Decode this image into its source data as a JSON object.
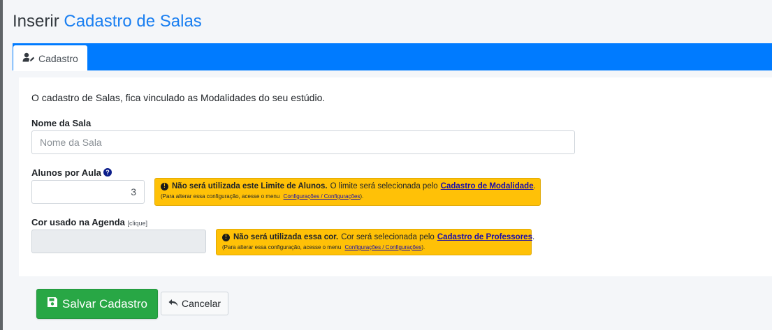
{
  "header": {
    "title_prefix": "Inserir",
    "title_main": "Cadastro de Salas"
  },
  "tabs": [
    {
      "label": "Cadastro",
      "icon": "user-edit-icon",
      "active": true
    }
  ],
  "form": {
    "intro": "O cadastro de Salas, fica vinculado as Modalidades do seu estúdio.",
    "nome_sala": {
      "label": "Nome da Sala",
      "placeholder": "Nome da Sala",
      "value": ""
    },
    "alunos_por_aula": {
      "label": "Alunos por Aula",
      "help_icon": "question-circle-icon",
      "value": "3",
      "alert": {
        "bold": "Não será utilizada este Limite de Alunos.",
        "text": "O limite será selecionada pelo",
        "link": "Cadastro de Modalidade",
        "end": ".",
        "small_text": "(Para alterar essa configuração, acesse o menu",
        "small_link": "Configurações / Configurações",
        "small_end": ")."
      }
    },
    "cor_agenda": {
      "label": "Cor usado na Agenda",
      "hint": "[clique]",
      "value": "",
      "alert": {
        "bold": "Não será utilizada essa cor.",
        "text": "Cor será selecionada pelo",
        "link": "Cadastro de Professores",
        "end": ".",
        "small_text": "(Para alterar essa configuração, acesse o menu",
        "small_link": "Configurações / Configurações",
        "small_end": ")."
      }
    }
  },
  "actions": {
    "save_label": "Salvar Cadastro",
    "save_icon": "save-icon",
    "cancel_label": "Cancelar",
    "cancel_icon": "undo-icon"
  },
  "colors": {
    "primary": "#007bff",
    "success": "#28a745",
    "warning": "#ffc107",
    "title_accent": "#1a7ff1"
  }
}
